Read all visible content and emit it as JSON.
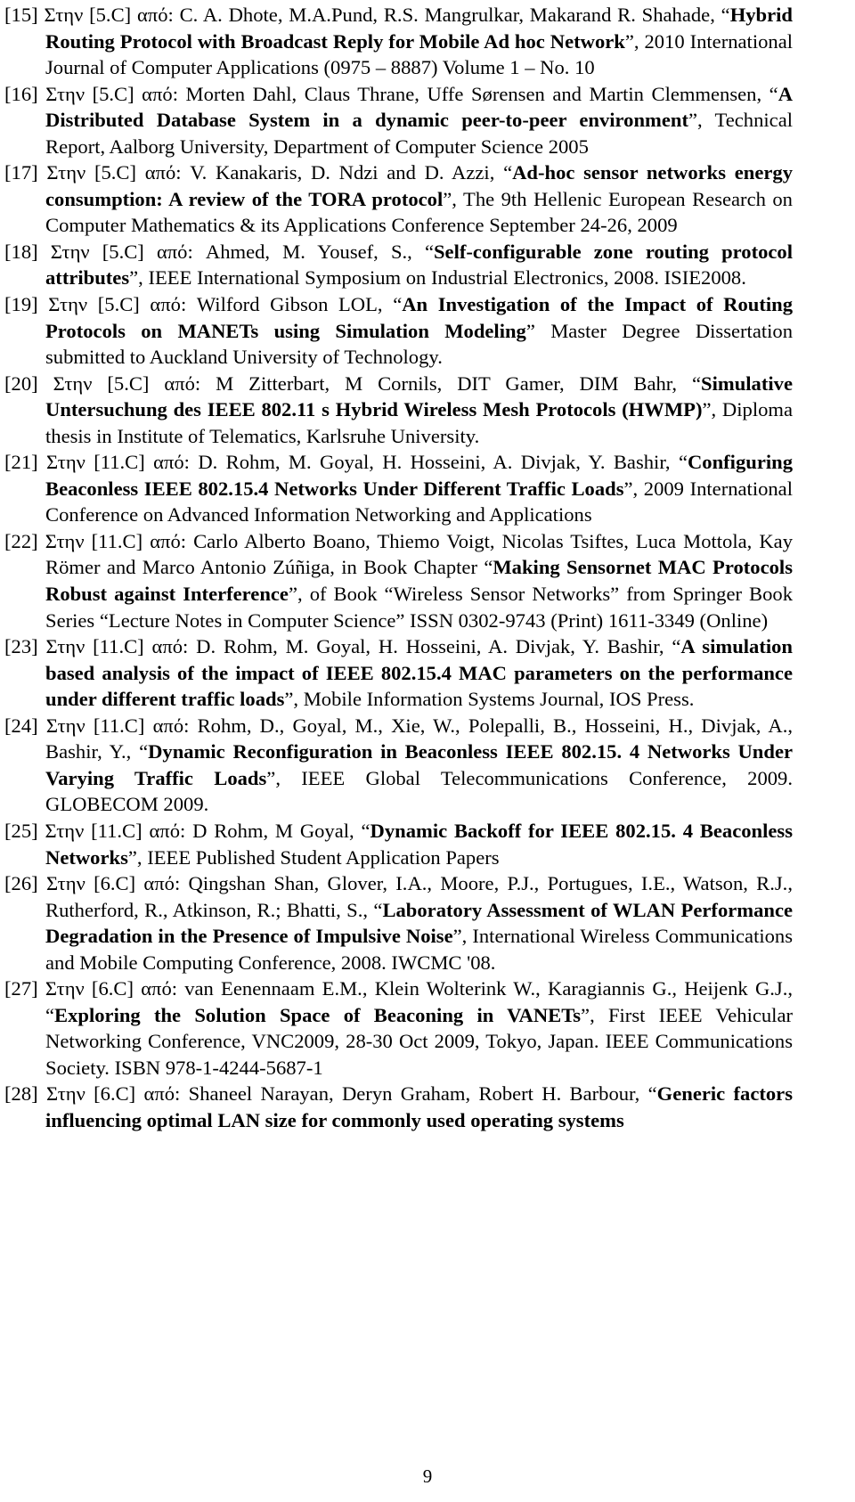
{
  "page": {
    "page_number": "9",
    "section": "references"
  },
  "references": [
    {
      "id": "ref-15",
      "number": "[15]",
      "prefix": "Στην [5.C] από: ",
      "authors": "C. A. Dhote, M.A.Pund, R.S. Mangrulkar, Makarand R. Shahade, ",
      "open_quote": "“",
      "title": "Hybrid Routing Protocol with Broadcast Reply for Mobile Ad hoc Network",
      "close_quote": "”",
      "venue": ", 2010 International Journal of Computer Applications (0975 – 8887) Volume 1 – No. 10"
    },
    {
      "id": "ref-16",
      "number": "[16]",
      "prefix": "Στην [5.C] από: ",
      "authors": "Morten Dahl, Claus Thrane, Uffe Sørensen and Martin Clemmensen, ",
      "open_quote": "“",
      "title": "A Distributed Database System in a dynamic peer-to-peer environment",
      "close_quote": "”",
      "venue": ", Technical Report, Aalborg University, Department of Computer Science 2005"
    },
    {
      "id": "ref-17",
      "number": "[17]",
      "prefix": "Στην [5.C] από: ",
      "authors": "V. Kanakaris, D. Ndzi and D. Azzi, ",
      "open_quote": "“",
      "title": "Ad-hoc sensor networks energy consumption: A review of the TORA protocol",
      "close_quote": "”",
      "venue": ", The 9th Hellenic European Research on Computer Mathematics & its Applications Conference September 24-26, 2009"
    },
    {
      "id": "ref-18",
      "number": "[18]",
      "prefix": "Στην [5.C] από: ",
      "authors": "Ahmed, M.   Yousef, S., ",
      "open_quote": "“",
      "title": "Self-configurable zone routing protocol attributes",
      "close_quote": "”",
      "venue": ", IEEE International Symposium on Industrial Electronics, 2008. ISIE2008."
    },
    {
      "id": "ref-19",
      "number": "[19]",
      "prefix": "Στην [5.C] από: ",
      "authors": "Wilford Gibson LOL, ",
      "open_quote": "“",
      "title": "An Investigation of the Impact of Routing Protocols on MANETs using Simulation Modeling",
      "close_quote": "”",
      "venue": " Master Degree Dissertation submitted to Auckland University of Technology."
    },
    {
      "id": "ref-20",
      "number": "[20]",
      "prefix": "Στην [5.C] από: ",
      "authors": "M Zitterbart, M Cornils, DIT Gamer, DIM Bahr, ",
      "open_quote": "“",
      "title": "Simulative Untersuchung des IEEE 802.11 s Hybrid Wireless Mesh Protocols (HWMP)",
      "close_quote": "”",
      "venue": ", Diploma thesis in Institute of Telematics, Karlsruhe University."
    },
    {
      "id": "ref-21",
      "number": "[21]",
      "prefix": "Στην [11.C] από: ",
      "authors": "D. Rohm, M. Goyal, H. Hosseini, A. Divjak, Y. Bashir, ",
      "open_quote": "“",
      "title": "Configuring Beaconless IEEE 802.15.4 Networks Under Different Traffic Loads",
      "close_quote": "”",
      "venue": ", 2009 International Conference on Advanced Information Networking and Applications"
    },
    {
      "id": "ref-22",
      "number": "[22]",
      "prefix": "Στην [11.C] από: ",
      "authors": "Carlo Alberto Boano, Thiemo Voigt, Nicolas Tsiftes, Luca Mottola, Kay Römer and Marco Antonio Zúñiga, in Book Chapter ",
      "open_quote": "“",
      "title": "Making Sensornet MAC Protocols Robust against Interference",
      "close_quote": "”",
      "venue": ", of Book “Wireless Sensor Networks” from Springer Book Series “Lecture Notes in Computer Science” ISSN    0302-9743 (Print) 1611-3349 (Online)"
    },
    {
      "id": "ref-23",
      "number": "[23]",
      "prefix": "Στην [11.C] από: ",
      "authors": "D. Rohm, M. Goyal, H. Hosseini, A. Divjak, Y. Bashir, ",
      "open_quote": "“",
      "title": "A simulation based analysis of the impact of IEEE 802.15.4 MAC parameters on the performance under different traffic loads",
      "close_quote": "”",
      "venue": ", Mobile Information Systems Journal, IOS Press."
    },
    {
      "id": "ref-24",
      "number": "[24]",
      "prefix": "Στην [11.C] από: ",
      "authors": "Rohm, D., Goyal, M., Xie, W., Polepalli, B., Hosseini, H., Divjak, A., Bashir, Y., ",
      "open_quote": "“",
      "title": "Dynamic Reconfiguration in Beaconless IEEE 802.15. 4 Networks Under Varying Traffic Loads",
      "close_quote": "”",
      "venue": ", IEEE Global Telecommunications Conference, 2009. GLOBECOM 2009."
    },
    {
      "id": "ref-25",
      "number": "[25]",
      "prefix": "Στην [11.C] από: ",
      "authors": "D Rohm, M Goyal, ",
      "open_quote": "“",
      "title": "Dynamic Backoff for IEEE 802.15. 4 Beaconless Networks",
      "close_quote": "”",
      "venue": ", IEEE Published Student Application Papers"
    },
    {
      "id": "ref-26",
      "number": "[26]",
      "prefix": "Στην [6.C] από: ",
      "authors": "Qingshan Shan, Glover, I.A., Moore, P.J., Portugues, I.E., Watson, R.J., Rutherford, R., Atkinson, R.; Bhatti, S., ",
      "open_quote": "“",
      "title": "Laboratory Assessment of WLAN Performance Degradation in the Presence of Impulsive Noise",
      "close_quote": "”",
      "venue": ", International Wireless Communications and Mobile Computing Conference, 2008. IWCMC '08."
    },
    {
      "id": "ref-27",
      "number": "[27]",
      "prefix": "Στην [6.C] από: ",
      "authors": "van Eenennaam E.M., Klein Wolterink W., Karagiannis G., Heijenk G.J., ",
      "open_quote": "“",
      "title": "Exploring the Solution Space of Beaconing in VANETs",
      "close_quote": "”",
      "venue": ", First IEEE Vehicular Networking Conference, VNC2009, 28-30 Oct 2009, Tokyo, Japan. IEEE Communications Society. ISBN 978-1-4244-5687-1"
    },
    {
      "id": "ref-28",
      "number": "[28]",
      "prefix": "Στην [6.C] από: ",
      "authors": "Shaneel Narayan, Deryn Graham, Robert H. Barbour, ",
      "open_quote": "“",
      "title": "Generic factors influencing optimal LAN size for commonly used operating systems",
      "close_quote": "",
      "venue": ""
    }
  ]
}
